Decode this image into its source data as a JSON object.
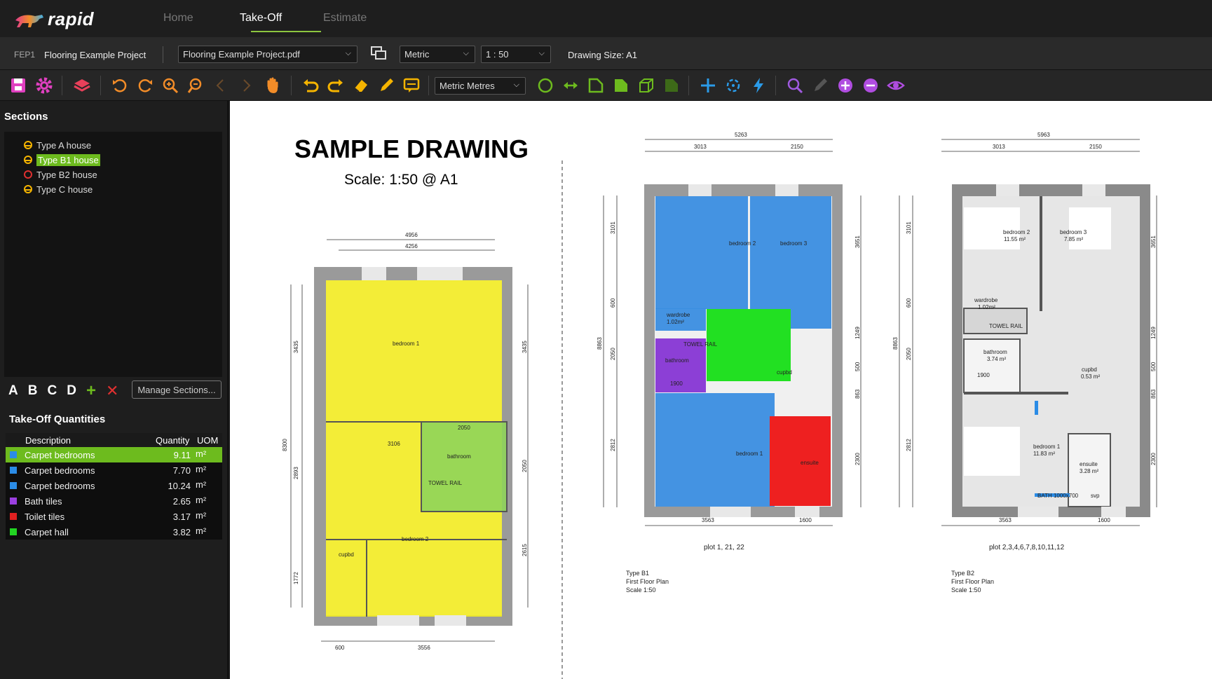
{
  "nav": {
    "brand": "rapid",
    "tabs": [
      {
        "label": "Home"
      },
      {
        "label": "Take-Off"
      },
      {
        "label": "Estimate"
      }
    ]
  },
  "project_bar": {
    "code": "FEP1",
    "name": "Flooring Example Project",
    "file": "Flooring Example Project.pdf",
    "units": "Metric",
    "scale": "1 : 50",
    "drawing_size": "Drawing Size: A1"
  },
  "toolbar": {
    "measure_units": "Metric Metres"
  },
  "sections": {
    "title": "Sections",
    "items": [
      {
        "label": "Type A house"
      },
      {
        "label": "Type B1 house"
      },
      {
        "label": "Type B2 house"
      },
      {
        "label": "Type C house"
      }
    ],
    "letters": [
      "A",
      "B",
      "C",
      "D"
    ],
    "manage_label": "Manage Sections..."
  },
  "takeoff": {
    "title": "Take-Off Quantities",
    "headers": {
      "description": "Description",
      "quantity": "Quantity",
      "uom": "UOM"
    },
    "rows": [
      {
        "description": "Carpet bedrooms",
        "quantity": "9.11",
        "uom": "m²",
        "color": "#2b8ce6"
      },
      {
        "description": "Carpet bedrooms",
        "quantity": "7.70",
        "uom": "m²",
        "color": "#2b8ce6"
      },
      {
        "description": "Carpet bedrooms",
        "quantity": "10.24",
        "uom": "m²",
        "color": "#2b8ce6"
      },
      {
        "description": "Bath tiles",
        "quantity": "2.65",
        "uom": "m²",
        "color": "#9b3fe0"
      },
      {
        "description": "Toilet tiles",
        "quantity": "3.17",
        "uom": "m²",
        "color": "#e02020"
      },
      {
        "description": "Carpet hall",
        "quantity": "3.82",
        "uom": "m²",
        "color": "#22d422"
      }
    ]
  },
  "drawing": {
    "title": "SAMPLE DRAWING",
    "scale": "Scale: 1:50 @ A1",
    "plan_a": {
      "dims_top": [
        "4956",
        "4256"
      ],
      "dims_left": [
        "3435",
        "2893",
        "1772",
        "8300"
      ],
      "dims_right": [
        "3435",
        "2050",
        "2615"
      ],
      "dims_bottom": [
        "600",
        "3556"
      ],
      "rooms": [
        "bedroom 1",
        "bathroom",
        "bedroom 2",
        "cupbd",
        "TOWEL RAIL"
      ],
      "inner_dims": [
        "2050",
        "3106"
      ]
    },
    "plan_b1": {
      "dims_top": [
        "5263",
        "3013",
        "2150"
      ],
      "dims_left": [
        "3101",
        "600",
        "2050",
        "2812",
        "8863"
      ],
      "dims_right": [
        "3651",
        "1249",
        "500",
        "863",
        "2300"
      ],
      "dims_bottom": [
        "3563",
        "1600"
      ],
      "rooms": [
        "bedroom 2",
        "bedroom 3",
        "wardrobe",
        "1.02m²",
        "TOWEL RAIL",
        "bathroom",
        "1900",
        "cupbd",
        "bedroom 1",
        "ensuite"
      ],
      "caption": "plot 1, 21, 22",
      "type_lines": [
        "Type B1",
        "First Floor Plan",
        "Scale 1:50"
      ]
    },
    "plan_b2": {
      "dims_top": [
        "5963",
        "3013",
        "2150"
      ],
      "dims_left": [
        "3101",
        "600",
        "2050",
        "2812",
        "8863"
      ],
      "dims_right": [
        "3651",
        "1249",
        "500",
        "863",
        "2300"
      ],
      "dims_bottom": [
        "3563",
        "1600"
      ],
      "rooms": [
        "bedroom 2",
        "11.55 m²",
        "bedroom 3",
        "7.85 m²",
        "wardrobe",
        "1.02m²",
        "TOWEL RAIL",
        "bathroom",
        "3.74 m²",
        "1900",
        "cupbd",
        "0.53 m²",
        "bedroom 1",
        "11.83 m²",
        "ensuite",
        "3.28 m²",
        "svp",
        "BATH 1000x700"
      ],
      "caption": "plot 2,3,4,6,7,8,10,11,12",
      "type_lines": [
        "Type B2",
        "First Floor Plan",
        "Scale 1:50"
      ]
    }
  }
}
